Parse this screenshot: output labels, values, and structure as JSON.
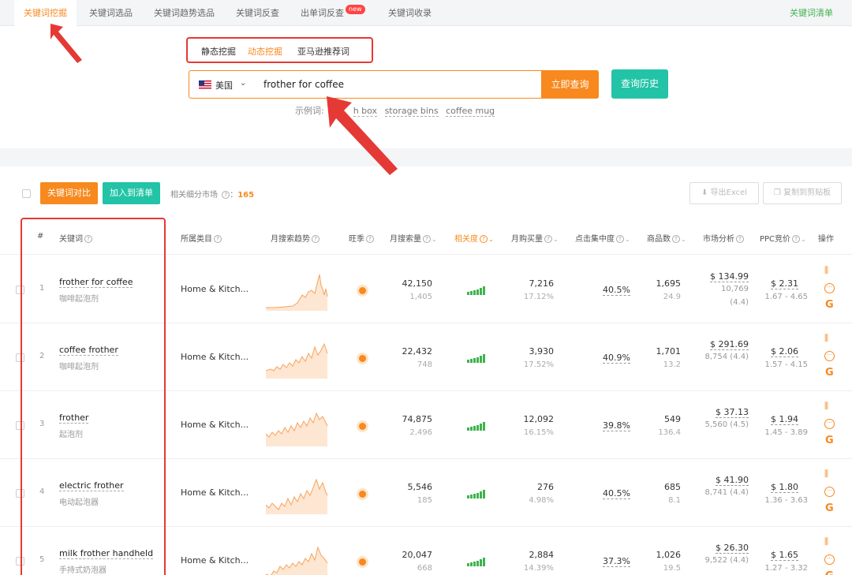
{
  "topbar": {
    "tabs": [
      "关键词挖掘",
      "关键词选品",
      "关键词趋势选品",
      "关键词反查",
      "出单词反查",
      "关键词收录"
    ],
    "new_badge": "new",
    "right_link": "关键词清单"
  },
  "search": {
    "subtabs": [
      "静态挖掘",
      "动态挖掘",
      "亚马逊推荐词"
    ],
    "country": "美国",
    "query": "frother for coffee",
    "search_btn": "立即查询",
    "history_btn": "查询历史",
    "examples_label": "示例词:",
    "examples": [
      "h box",
      "storage bins",
      "coffee mug"
    ]
  },
  "toolbar": {
    "compare_btn": "关键词对比",
    "addlist_btn": "加入到清单",
    "market_label": "相关细分市场",
    "market_count": "165",
    "export_btn": "导出Excel",
    "copy_btn": "复制到剪贴板"
  },
  "columns": {
    "idx": "#",
    "keyword": "关键词",
    "category": "所属类目",
    "trend": "月搜索趋势",
    "season": "旺季",
    "search_vol": "月搜索量",
    "relevance": "相关度",
    "purchase": "月购买量",
    "click_conc": "点击集中度",
    "products": "商品数",
    "market": "市场分析",
    "ppc": "PPC竞价",
    "ops": "操作"
  },
  "rows": [
    {
      "idx": "1",
      "kw": "frother for coffee",
      "cn": "咖啡起泡剂",
      "cat": "Home & Kitch...",
      "sv": "42,150",
      "sv2": "1,405",
      "pv": "7,216",
      "pv2": "17.12%",
      "cc": "40.5%",
      "pn": "1,695",
      "pn2": "24.9",
      "mp": "$ 134.99",
      "mr": "10,769",
      "mr2": "(4.4)",
      "ppc": "$ 2.31",
      "ppc2": "1.67 - 4.65"
    },
    {
      "idx": "2",
      "kw": "coffee frother",
      "cn": "咖啡起泡剂",
      "cat": "Home & Kitch...",
      "sv": "22,432",
      "sv2": "748",
      "pv": "3,930",
      "pv2": "17.52%",
      "cc": "40.9%",
      "pn": "1,701",
      "pn2": "13.2",
      "mp": "$ 291.69",
      "mr": "8,754 (4.4)",
      "mr2": "",
      "ppc": "$ 2.06",
      "ppc2": "1.57 - 4.15"
    },
    {
      "idx": "3",
      "kw": "frother",
      "cn": "起泡剂",
      "cat": "Home & Kitch...",
      "sv": "74,875",
      "sv2": "2,496",
      "pv": "12,092",
      "pv2": "16.15%",
      "cc": "39.8%",
      "pn": "549",
      "pn2": "136.4",
      "mp": "$ 37.13",
      "mr": "5,560 (4.5)",
      "mr2": "",
      "ppc": "$ 1.94",
      "ppc2": "1.45 - 3.89"
    },
    {
      "idx": "4",
      "kw": "electric frother",
      "cn": "电动起泡器",
      "cat": "Home & Kitch...",
      "sv": "5,546",
      "sv2": "185",
      "pv": "276",
      "pv2": "4.98%",
      "cc": "40.5%",
      "pn": "685",
      "pn2": "8.1",
      "mp": "$ 41.90",
      "mr": "8,741 (4.4)",
      "mr2": "",
      "ppc": "$ 1.80",
      "ppc2": "1.36 - 3.63"
    },
    {
      "idx": "5",
      "kw": "milk frother handheld",
      "cn": "手持式奶泡器",
      "cat": "Home & Kitch...",
      "sv": "20,047",
      "sv2": "668",
      "pv": "2,884",
      "pv2": "14.39%",
      "cc": "37.3%",
      "pn": "1,026",
      "pn2": "19.5",
      "mp": "$ 26.30",
      "mr": "9,522 (4.4)",
      "mr2": "",
      "ppc": "$ 1.65",
      "ppc2": "1.27 - 3.32"
    }
  ]
}
